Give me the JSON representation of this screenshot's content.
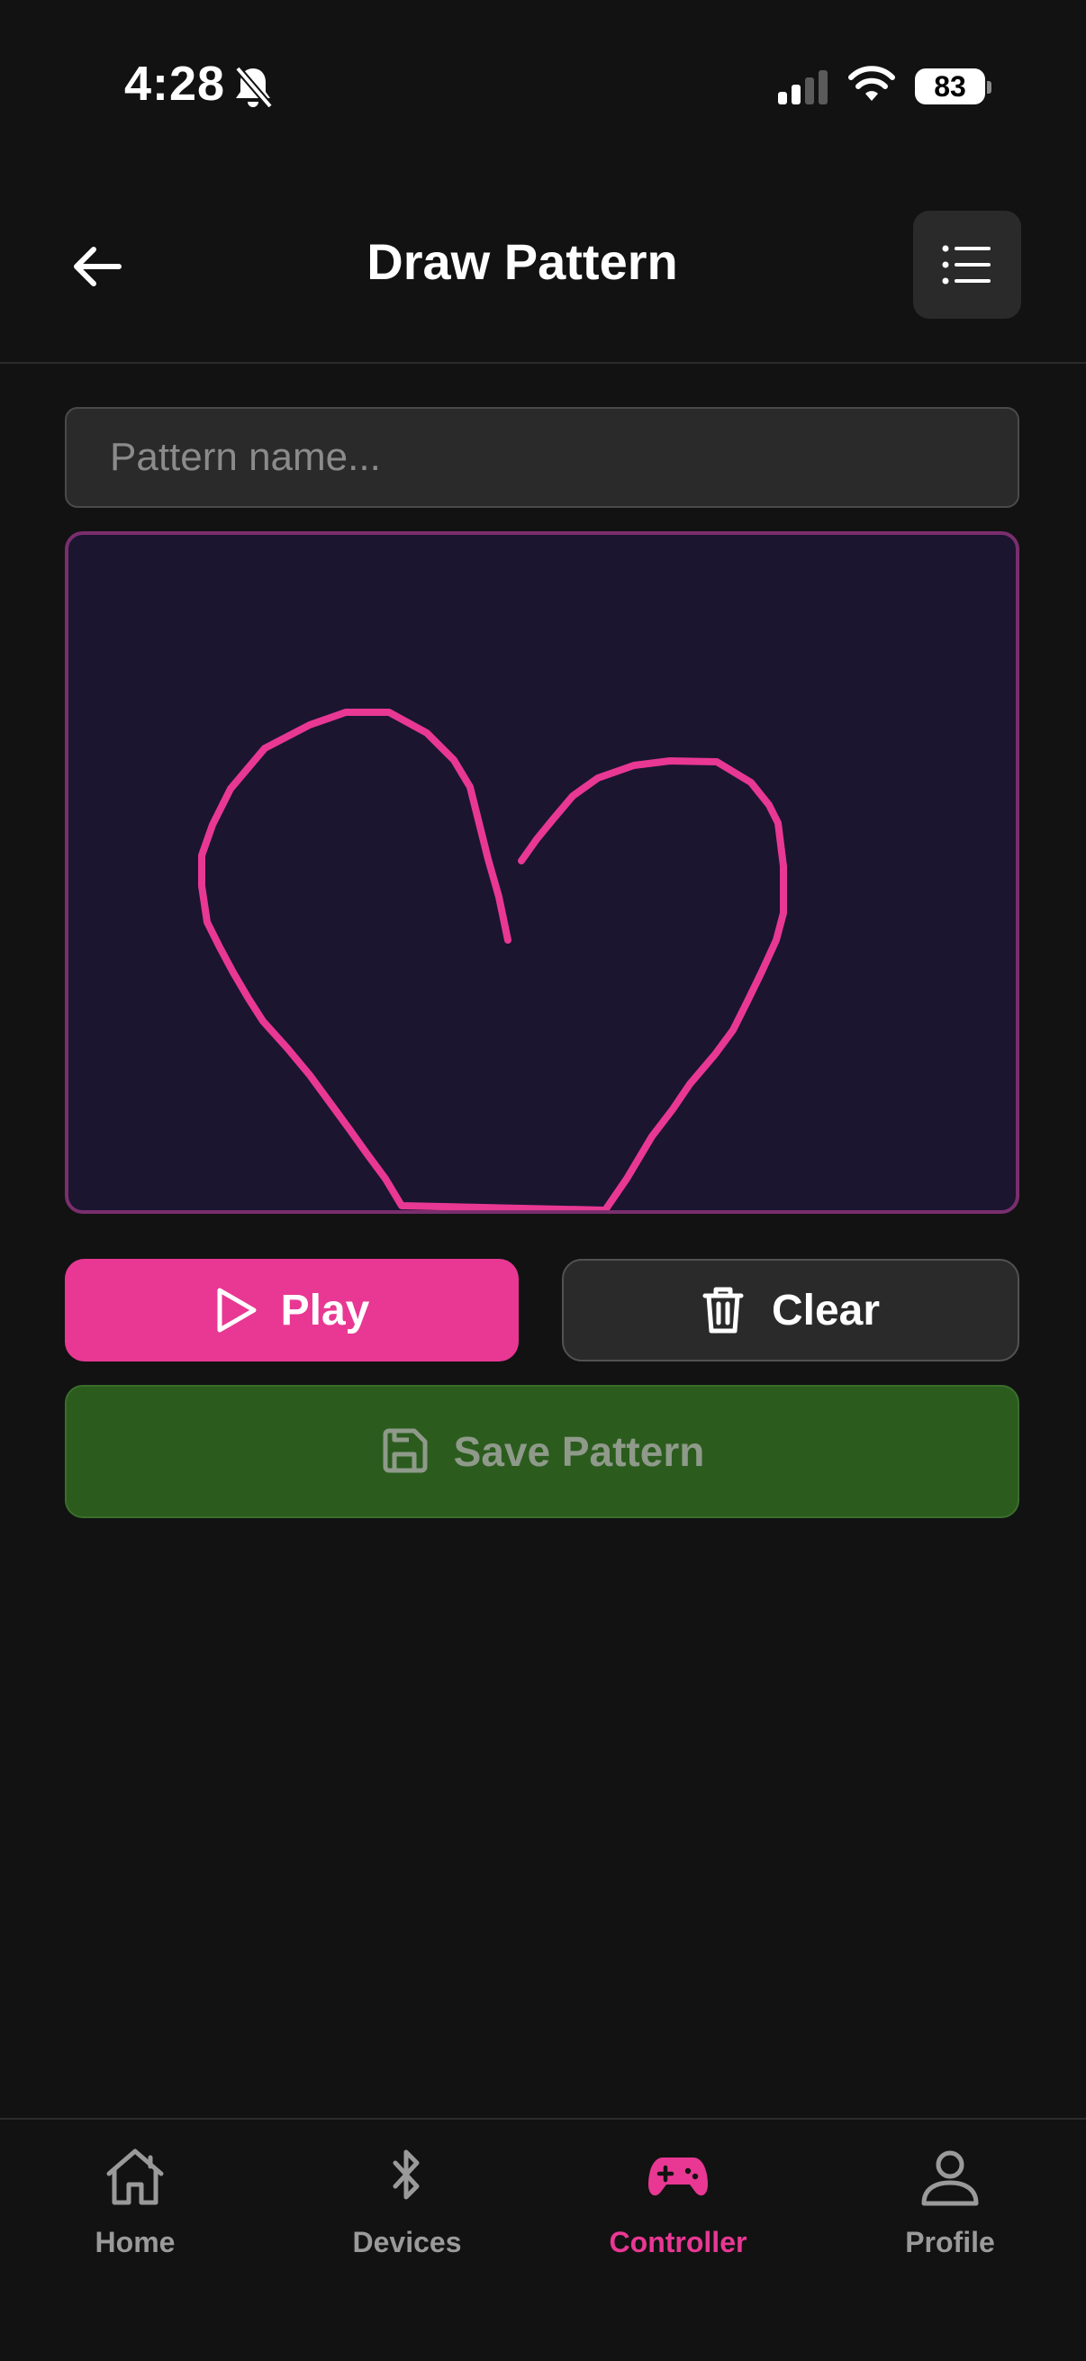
{
  "status_bar": {
    "time": "4:28",
    "battery": "83",
    "icons": [
      "bell-slash-icon",
      "signal-icon",
      "wifi-icon",
      "battery-icon"
    ]
  },
  "header": {
    "title": "Draw Pattern",
    "back_icon": "arrow-left-icon",
    "menu_icon": "list-icon"
  },
  "pattern": {
    "name_value": "",
    "name_placeholder": "Pattern name...",
    "stroke_color": "#e83893",
    "canvas_color": "#1b1530"
  },
  "actions": {
    "play_label": "Play",
    "clear_label": "Clear",
    "save_label": "Save Pattern"
  },
  "colors": {
    "accent": "#e83893",
    "save_bg": "#2b5c1e",
    "background": "#121212"
  },
  "nav": {
    "items": [
      {
        "label": "Home",
        "icon": "home-icon",
        "active": false
      },
      {
        "label": "Devices",
        "icon": "bluetooth-icon",
        "active": false
      },
      {
        "label": "Controller",
        "icon": "gamepad-icon",
        "active": true
      },
      {
        "label": "Profile",
        "icon": "user-icon",
        "active": false
      }
    ]
  }
}
